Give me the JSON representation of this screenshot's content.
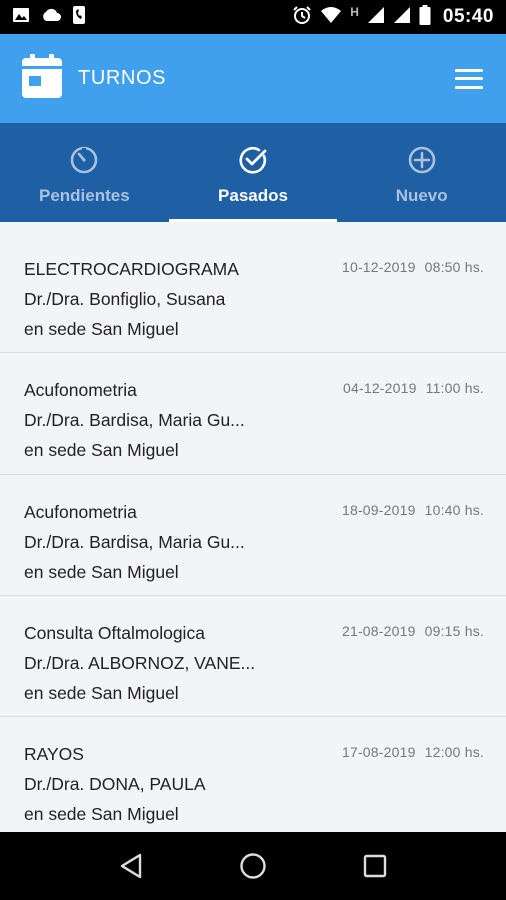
{
  "status_bar": {
    "time": "05:40",
    "network_letter": "H",
    "icons": [
      "image-icon",
      "cloud-icon",
      "phone-icon",
      "alarm-icon",
      "wifi-icon",
      "signal-icon",
      "signal-icon",
      "battery-icon"
    ]
  },
  "app_bar": {
    "title": "TURNOS",
    "icon": "calendar-icon",
    "menu_icon": "hamburger-menu-icon"
  },
  "tabs": [
    {
      "label": "Pendientes",
      "icon": "timer-icon",
      "active": false
    },
    {
      "label": "Pasados",
      "icon": "check-circle-icon",
      "active": true
    },
    {
      "label": "Nuevo",
      "icon": "plus-circle-icon",
      "active": false
    }
  ],
  "appointments": [
    {
      "title": "ELECTROCARDIOGRAMA",
      "doctor": "Dr./Dra. Bonfiglio, Susana",
      "location": "en sede San Miguel",
      "date": "10-12-2019",
      "time": "08:50 hs."
    },
    {
      "title": "Acufonometria",
      "doctor": "Dr./Dra. Bardisa, Maria Gu...",
      "location": "en sede San Miguel",
      "date": "04-12-2019",
      "time": "11:00 hs."
    },
    {
      "title": "Acufonometria",
      "doctor": "Dr./Dra. Bardisa, Maria Gu...",
      "location": "en sede San Miguel",
      "date": "18-09-2019",
      "time": "10:40 hs."
    },
    {
      "title": "Consulta Oftalmologica",
      "doctor": "Dr./Dra. ALBORNOZ, VANE...",
      "location": "en sede San Miguel",
      "date": "21-08-2019",
      "time": "09:15 hs."
    },
    {
      "title": "RAYOS",
      "doctor": "Dr./Dra. DONA, PAULA",
      "location": "en sede San Miguel",
      "date": "17-08-2019",
      "time": "12:00 hs."
    }
  ],
  "nav_bar": {
    "buttons": [
      "back-icon",
      "home-icon",
      "recents-icon"
    ]
  },
  "colors": {
    "app_bar": "#41a0ee",
    "tab_bar": "#1f5fa3",
    "background": "#f3f4f7"
  }
}
